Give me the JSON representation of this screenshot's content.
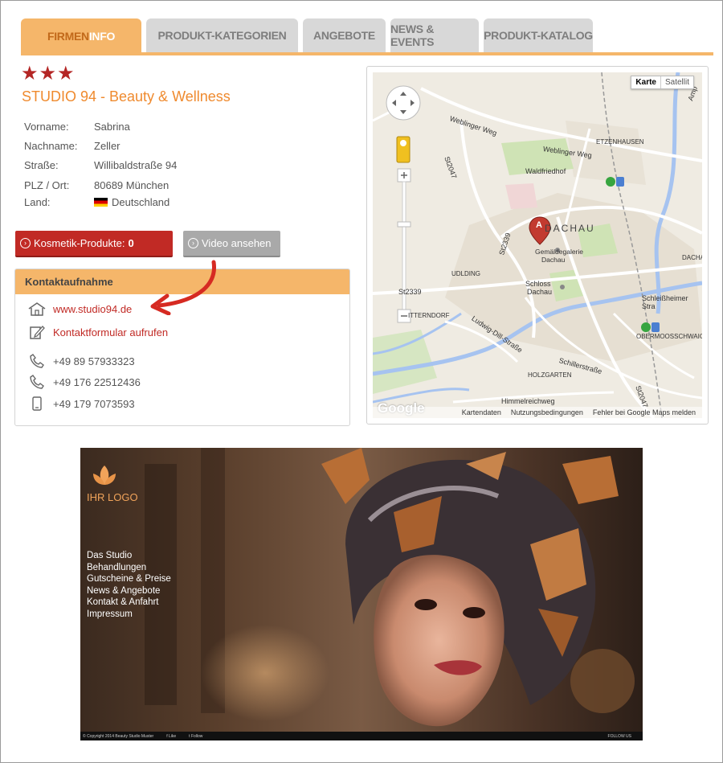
{
  "tabs": [
    {
      "label_a": "FIRMEN",
      "label_b": "INFO",
      "active": true
    },
    {
      "label": "PRODUKT-KATEGORIEN"
    },
    {
      "label": "ANGEBOTE"
    },
    {
      "label": "NEWS & EVENTS"
    },
    {
      "label": "PRODUKT-KATALOG"
    }
  ],
  "rating": {
    "stars": "★★★",
    "value": 3
  },
  "company": {
    "title": "STUDIO 94 - Beauty & Wellness",
    "fields": [
      {
        "label": "Vorname:",
        "value": "Sabrina"
      },
      {
        "label": "Nachname:",
        "value": "Zeller"
      },
      {
        "label": "Straße:",
        "value": "Willibaldstraße 94"
      },
      {
        "label": "PLZ / Ort:",
        "value": "80689 München"
      },
      {
        "label": "Land:",
        "value": "Deutschland"
      }
    ]
  },
  "buttons": {
    "products_label": "Kosmetik-Produkte:",
    "products_count": "0",
    "video_label": "Video ansehen"
  },
  "contact": {
    "heading": "Kontaktaufnahme",
    "website": "www.studio94.de",
    "form": "Kontaktformular aufrufen",
    "phones": [
      "+49 89 57933323",
      "+49 176 22512436",
      "+49 179 7073593"
    ]
  },
  "map": {
    "type_map": "Karte",
    "type_sat": "Satellit",
    "marker": "A",
    "labels": {
      "dachau": "DACHAU",
      "etzenhausen": "ETZENHAUSEN",
      "waldfriedhof": "Waldfriedhof",
      "weblinger1": "Weblinger Weg",
      "weblinger2": "Weblinger Weg",
      "st2047a": "St2047",
      "st2047b": "St2047",
      "st2339a": "St2339",
      "st2339b": "St2339",
      "gemaelde1": "Gemäldegalerie",
      "gemaelde2": "Dachau",
      "schloss1": "Schloss",
      "schloss2": "Dachau",
      "udlding": "UDLDING",
      "itternorf": "ITTERNDORF",
      "ludwig": "Ludwig-Dill-Straße",
      "schleiss": "Schleißheimer Stra",
      "obermoos": "OBERMOOSSCHWAIGE",
      "schiller": "Schillerstraße",
      "holzgarten": "HOLZGARTEN",
      "himmel": "Himmelreichweg",
      "dacha": "DACHA",
      "amp": "Amp"
    },
    "footer": [
      "Kartendaten",
      "Nutzungsbedingungen",
      "Fehler bei Google Maps melden"
    ],
    "google": "Google"
  },
  "preview": {
    "logo": "IHR LOGO",
    "nav": [
      "Das Studio",
      "Behandlungen",
      "Gutscheine & Preise",
      "News & Angebote",
      "Kontakt & Anfahrt",
      "Impressum"
    ],
    "copyright": "© Copyright 2014 Beauty Studio Muster",
    "like": "Like",
    "follow": "Follow",
    "follow_us": "FOLLOW US"
  }
}
